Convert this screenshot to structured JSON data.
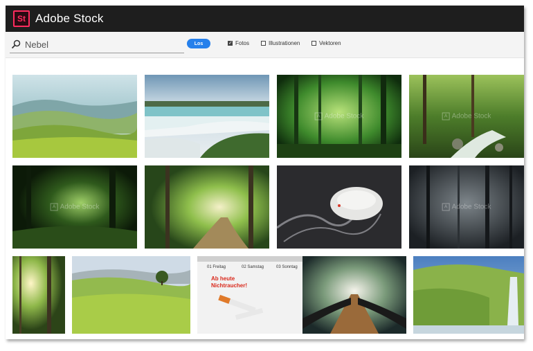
{
  "header": {
    "logo_text": "St",
    "app_title": "Adobe Stock",
    "logo_color": "#ff2b5e"
  },
  "search": {
    "value": "Nebel",
    "button_label": "Los",
    "icon": "search-icon"
  },
  "filters": [
    {
      "label": "Fotos",
      "checked": true
    },
    {
      "label": "Illustrationen",
      "checked": false
    },
    {
      "label": "Vektoren",
      "checked": false
    }
  ],
  "watermark": "Adobe Stock",
  "calendar": {
    "days": [
      "01 Freitag",
      "02 Samstag",
      "03 Sonntag"
    ],
    "note_line1": "Ab heute",
    "note_line2": "Nichtraucher!"
  }
}
